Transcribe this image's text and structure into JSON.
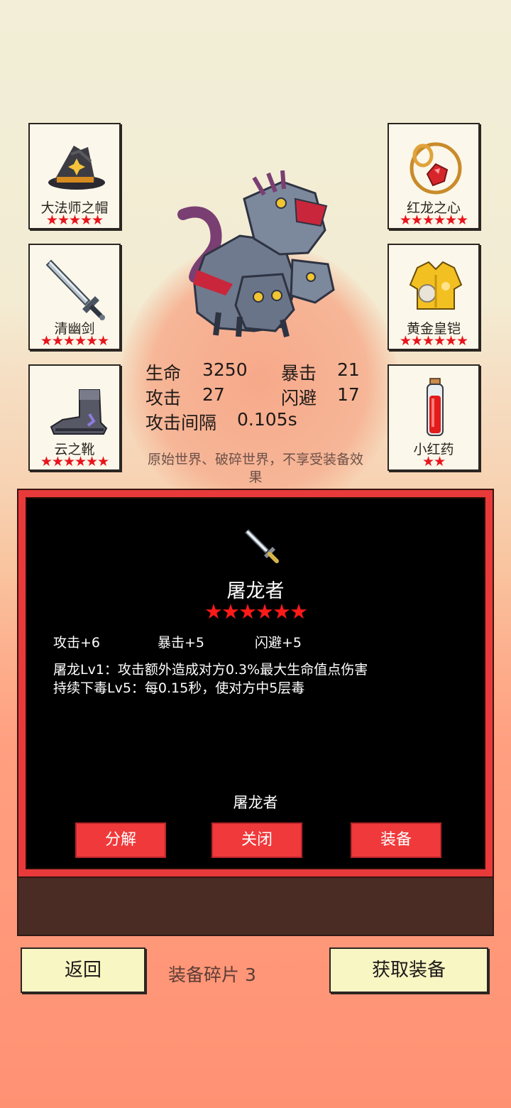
{
  "equipment": {
    "left": [
      {
        "name": "大法师之帽",
        "stars": "★★★★★",
        "icon": "wizard-hat-icon"
      },
      {
        "name": "清幽剑",
        "stars": "★★★★★★",
        "icon": "sword-icon"
      },
      {
        "name": "云之靴",
        "stars": "★★★★★★",
        "icon": "boots-icon"
      }
    ],
    "right": [
      {
        "name": "红龙之心",
        "stars": "★★★★★★",
        "icon": "red-gem-amulet-icon"
      },
      {
        "name": "黄金皇铠",
        "stars": "★★★★★★",
        "icon": "golden-armor-icon"
      },
      {
        "name": "小红药",
        "stars": "★★",
        "icon": "red-potion-icon"
      }
    ]
  },
  "stats": {
    "hp_label": "生命",
    "hp_value": "3250",
    "crit_label": "暴击",
    "crit_value": "21",
    "atk_label": "攻击",
    "atk_value": "27",
    "dodge_label": "闪避",
    "dodge_value": "17",
    "interval_label": "攻击间隔",
    "interval_value": "0.105s"
  },
  "note": "原始世界、破碎世界，不享受装备效果",
  "item_panel": {
    "icon": "dagger-icon",
    "title": "屠龙者",
    "stars": "★★★★★★",
    "attrs": [
      "攻击+6",
      "暴击+5",
      "闪避+5"
    ],
    "desc_lines": [
      "屠龙Lv1：攻击额外造成对方0.3%最大生命值点伤害",
      "持续下毒Lv5：每0.15秒，使对方中5层毒"
    ],
    "footer_name": "屠龙者",
    "buttons": {
      "decompose": "分解",
      "close": "关闭",
      "equip": "装备"
    }
  },
  "bottom": {
    "back": "返回",
    "shards": "装备碎片 3",
    "get_equipment": "获取装备"
  },
  "colors": {
    "star_red": "#e8141c",
    "button_red": "#f0393b",
    "button_cream": "#f8f7c4"
  },
  "hero_icon": "three-headed-dragon-icon"
}
